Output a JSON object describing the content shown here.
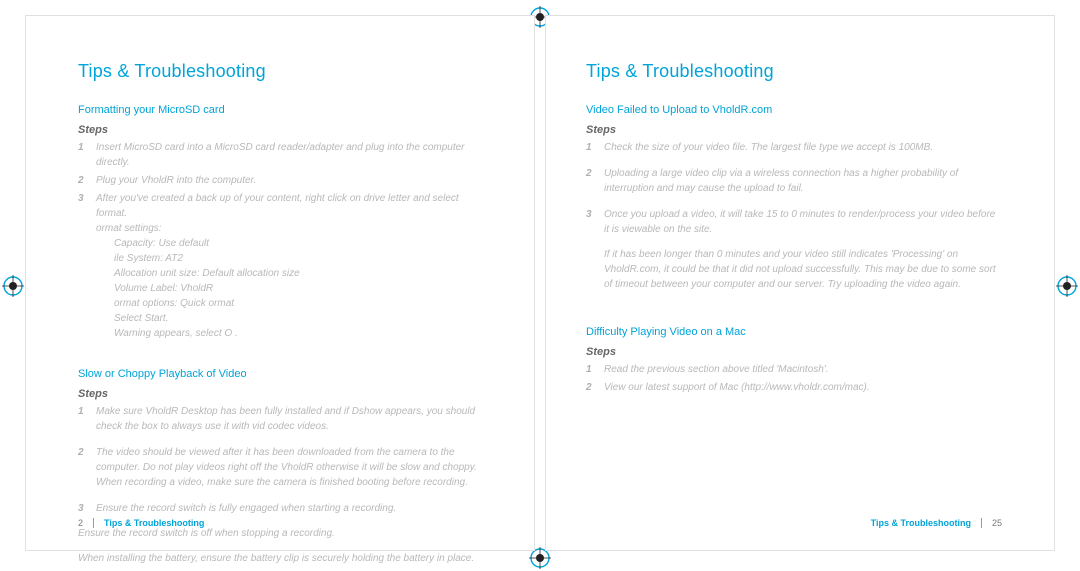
{
  "pages": {
    "left": {
      "title": "Tips & Troubleshooting",
      "section1": {
        "heading": "Formatting your MicroSD card",
        "steps_label": "Steps",
        "step1_num": "1",
        "step1": "Insert MicroSD card into a MicroSD card reader/adapter and plug into the computer directly.",
        "step2_num": "2",
        "step2": "Plug your VholdR into the computer.",
        "step3_num": "3",
        "step3": "After you've created a back up of your content, right click on drive letter and select format.",
        "sub1": "ormat settings:",
        "sub2": "Capacity: Use default",
        "sub3": "ile System: AT2",
        "sub4": "Allocation unit size: Default allocation size",
        "sub5": "Volume Label: VholdR",
        "sub6": "ormat options: Quick ormat",
        "sub7": "Select Start.",
        "sub8": "Warning appears, select O ."
      },
      "section2": {
        "heading": "Slow or Choppy Playback of Video",
        "steps_label": "Steps",
        "step1_num": "1",
        "step1": "Make sure VholdR Desktop has been fully installed and if Dshow appears, you should check the box to always use it with vid codec videos.",
        "step2_num": "2",
        "step2": "The video should be viewed after it has been downloaded from the camera to the computer.  Do not play videos right off the VholdR otherwise it will be slow and choppy.",
        "step2b": "When recording a video, make sure the camera is finished booting before recording.",
        "step3_num": "3",
        "step3": "Ensure the record switch is fully engaged when starting a recording.",
        "para1": "Ensure the record switch is off when stopping a recording.",
        "para2": "When installing the battery, ensure the battery clip is securely holding the battery in place."
      },
      "footer_num": "2",
      "footer_label": "Tips & Troubleshooting"
    },
    "right": {
      "title": "Tips & Troubleshooting",
      "section1": {
        "heading": "Video Failed to Upload to VholdR.com",
        "steps_label": "Steps",
        "step1_num": "1",
        "step1": "Check the size of your video file.  The largest file type we accept is 100MB.",
        "step2_num": "2",
        "step2": "Uploading a large video clip via a wireless connection has a higher probability of interruption and may cause the upload to fail.",
        "step3_num": "3",
        "step3": "Once you upload a video, it will take 15 to 0 minutes to render/process your video before it is viewable on the site.",
        "para1": "If it has been longer than 0 minutes and your video still indicates 'Processing' on VholdR.com, it could be that it did not upload successfully.  This may be due to some sort of timeout between your computer and our server.  Try uploading the video again."
      },
      "section2": {
        "heading": "Difficulty Playing Video on a Mac",
        "steps_label": "Steps",
        "step1_num": "1",
        "step1": "Read the previous section above titled 'Macintosh'.",
        "step2_num": "2",
        "step2": "View our latest support of Mac (http://www.vholdr.com/mac)."
      },
      "footer_label": "Tips & Troubleshooting",
      "footer_num": "25"
    }
  }
}
